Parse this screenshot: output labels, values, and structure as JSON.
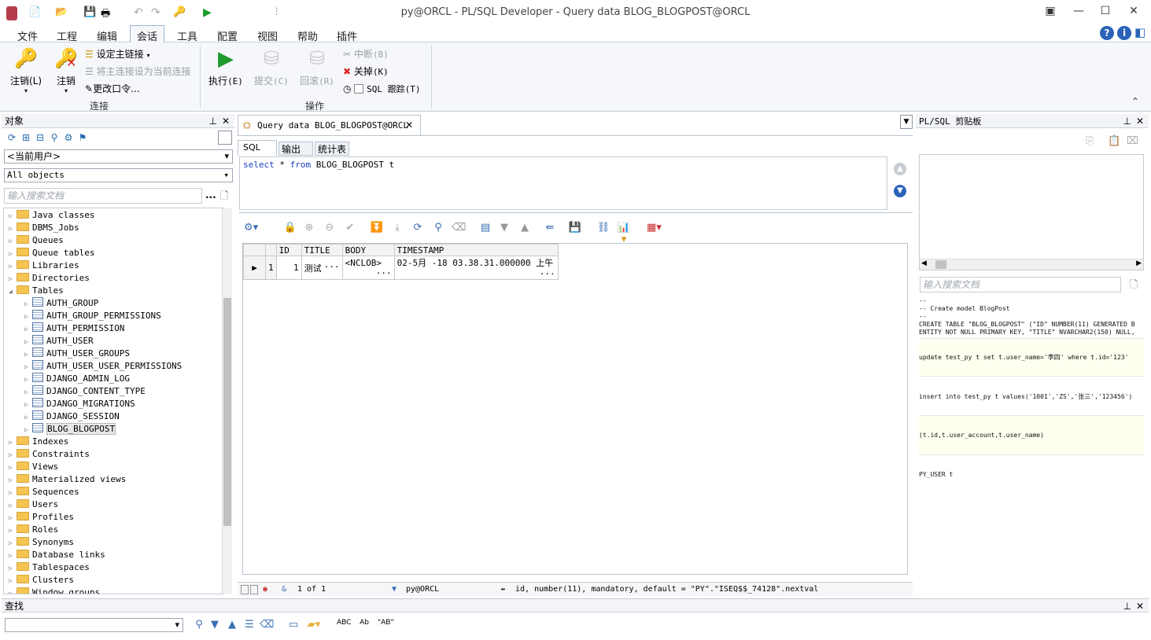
{
  "window": {
    "title": "py@ORCL - PL/SQL Developer - Query data BLOG_BLOGPOST@ORCL"
  },
  "menu": [
    "文件",
    "工程",
    "编辑",
    "会话",
    "工具",
    "配置",
    "视图",
    "帮助",
    "插件"
  ],
  "ribbon": {
    "logoff": "注销",
    "logoff_key": "(L)",
    "logoff2": "注销",
    "set_main": "设定主链接",
    "set_as_main": "将主连接设为当前连接",
    "change_pwd": "更改口令...",
    "group_connect": "连接",
    "execute": "执行",
    "execute_key": "(E)",
    "commit": "提交",
    "commit_key": "(C)",
    "rollback": "回滚",
    "rollback_key": "(R)",
    "break": "中断",
    "break_key": "(B)",
    "close": "关掉",
    "close_key": "(K)",
    "sqltrace": "SQL 跟踪",
    "sqltrace_key": "(T)",
    "group_action": "操作"
  },
  "objects": {
    "title": "对象",
    "user_select": "<当前用户>",
    "type_select": "All objects",
    "search_placeholder": "输入搜索文档",
    "search_btn": "...",
    "tree": [
      {
        "label": "Java classes",
        "kind": "folder",
        "level": 0
      },
      {
        "label": "DBMS_Jobs",
        "kind": "folder",
        "level": 0
      },
      {
        "label": "Queues",
        "kind": "folder",
        "level": 0
      },
      {
        "label": "Queue tables",
        "kind": "folder",
        "level": 0
      },
      {
        "label": "Libraries",
        "kind": "folder",
        "level": 0
      },
      {
        "label": "Directories",
        "kind": "folder",
        "level": 0
      },
      {
        "label": "Tables",
        "kind": "folder-open",
        "level": 0
      },
      {
        "label": "AUTH_GROUP",
        "kind": "table",
        "level": 1
      },
      {
        "label": "AUTH_GROUP_PERMISSIONS",
        "kind": "table",
        "level": 1
      },
      {
        "label": "AUTH_PERMISSION",
        "kind": "table",
        "level": 1
      },
      {
        "label": "AUTH_USER",
        "kind": "table",
        "level": 1
      },
      {
        "label": "AUTH_USER_GROUPS",
        "kind": "table",
        "level": 1
      },
      {
        "label": "AUTH_USER_USER_PERMISSIONS",
        "kind": "table",
        "level": 1
      },
      {
        "label": "DJANGO_ADMIN_LOG",
        "kind": "table",
        "level": 1
      },
      {
        "label": "DJANGO_CONTENT_TYPE",
        "kind": "table",
        "level": 1
      },
      {
        "label": "DJANGO_MIGRATIONS",
        "kind": "table",
        "level": 1
      },
      {
        "label": "DJANGO_SESSION",
        "kind": "table",
        "level": 1
      },
      {
        "label": "BLOG_BLOGPOST",
        "kind": "table",
        "level": 1
      },
      {
        "label": "Indexes",
        "kind": "folder",
        "level": 0
      },
      {
        "label": "Constraints",
        "kind": "folder",
        "level": 0
      },
      {
        "label": "Views",
        "kind": "folder",
        "level": 0
      },
      {
        "label": "Materialized views",
        "kind": "folder",
        "level": 0
      },
      {
        "label": "Sequences",
        "kind": "folder",
        "level": 0
      },
      {
        "label": "Users",
        "kind": "folder",
        "level": 0
      },
      {
        "label": "Profiles",
        "kind": "folder",
        "level": 0
      },
      {
        "label": "Roles",
        "kind": "folder",
        "level": 0
      },
      {
        "label": "Synonyms",
        "kind": "folder",
        "level": 0
      },
      {
        "label": "Database links",
        "kind": "folder",
        "level": 0
      },
      {
        "label": "Tablespaces",
        "kind": "folder",
        "level": 0
      },
      {
        "label": "Clusters",
        "kind": "folder",
        "level": 0
      },
      {
        "label": "Window groups",
        "kind": "folder",
        "level": 0
      }
    ]
  },
  "editor": {
    "tab_title": "Query data BLOG_BLOGPOST@ORCL",
    "subtabs": [
      "SQL",
      "输出",
      "统计表"
    ],
    "sql_kw1": "select",
    "sql_star": " * ",
    "sql_kw2": "from",
    "sql_rest": " BLOG_BLOGPOST t",
    "grid_headers": [
      "ID",
      "TITLE",
      "BODY",
      "TIMESTAMP"
    ],
    "grid_rows": [
      {
        "rownum": "1",
        "ID": "1",
        "TITLE": "测试",
        "TITLE_more": "···",
        "BODY": "<NCLOB>",
        "BODY_more": "···",
        "TIMESTAMP": "02-5月 -18 03.38.31.000000 上午",
        "TS_more": "···"
      }
    ],
    "status": {
      "record": "1 of 1",
      "connection": "py@ORCL",
      "column_info": "id, number(11), mandatory, default = \"PY\".\"ISEQ$$_74128\".nextval"
    }
  },
  "clipboard": {
    "title": "PL/SQL 剪贴板",
    "search_placeholder": "输入搜索文档",
    "entries": [
      {
        "lines": [
          "--",
          "-- Create model BlogPost",
          "--",
          "CREATE TABLE \"BLOG_BLOGPOST\" (\"ID\" NUMBER(11) GENERATED B",
          "ENTITY NOT NULL PRIMARY KEY, \"TITLE\" NVARCHAR2(150) NULL,"
        ]
      },
      {
        "lines": [
          "update test_py t set t.user_name='李四' where t.id='123'"
        ]
      },
      {
        "lines": [
          "insert into test_py t values('1001','ZS','张三','123456')"
        ]
      },
      {
        "lines": [
          "(t.id,t.user_account,t.user_name)"
        ]
      },
      {
        "lines": [
          "PY_USER t"
        ]
      }
    ]
  },
  "find": {
    "title": "查找"
  }
}
